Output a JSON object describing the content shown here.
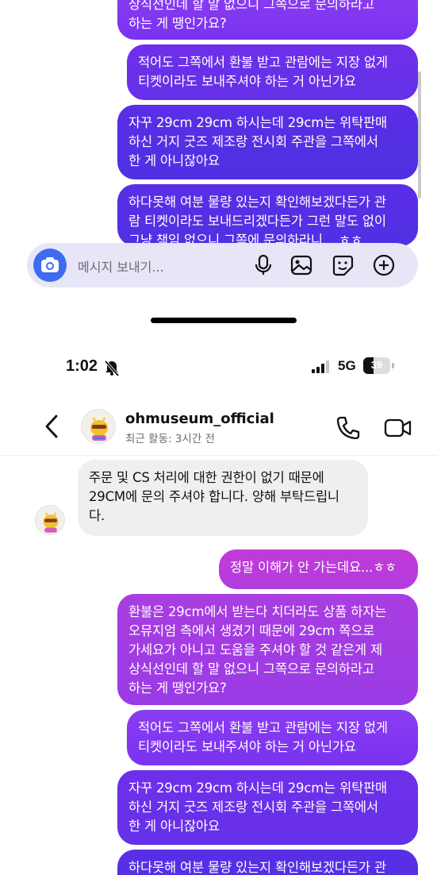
{
  "status_bar": {
    "time": "1:02",
    "network": "5G",
    "battery": "39",
    "battery_level": 0.39
  },
  "header": {
    "username": "ohmuseum_official",
    "activity": "최근 활동: 3시간 전"
  },
  "composer": {
    "placeholder": "메시지 보내기..."
  },
  "top_messages": [
    {
      "text": "상식선인데 할 말 없으니 그쪽으로 문의하라고\n하는 게 땡인가요?"
    },
    {
      "text": "적어도 그쪽에서 환불 받고 관람에는 지장 없게\n티켓이라도 보내주셔야 하는 거 아닌가요"
    },
    {
      "text": "자꾸 29cm 29cm 하시는데 29cm는 위탁판매\n하신 거지 굿즈 제조랑 전시회 주관을 그쪽에서\n한 게 아니잖아요"
    },
    {
      "text": "하다못해 여분 물량 있는지 확인해보겠다든가 관\n람 티켓이라도 보내드리겠다든가 그런 말도 없이\n그냥 책임 없으니 그쪽에 문의하라니... ㅎㅎ"
    }
  ],
  "bottom_messages": {
    "incoming": "주문 및 CS 처리에 대한 권한이 없기 때문에\n29CM에 문의 주셔야 합니다. 양해 부탁드립니\n다.",
    "outgoing": [
      {
        "text": "정말 이해가 안 가는데요...ㅎㅎ"
      },
      {
        "text": "환불은 29cm에서 받는다 치더라도 상품 하자는\n오뮤지엄 측에서 생겼기 때문에 29cm 쪽으로\n가세요가 아니고 도움을 주셔야 할 것 같은게 제\n상식선인데 할 말 없으니 그쪽으로 문의하라고\n하는 게 땡인가요?"
      },
      {
        "text": "적어도 그쪽에서 환불 받고 관람에는 지장 없게\n티켓이라도 보내주셔야 하는 거 아닌가요"
      },
      {
        "text": "자꾸 29cm 29cm 하시는데 29cm는 위탁판매\n하신 거지 굿즈 제조랑 전시회 주관을 그쪽에서\n한 게 아니잖아요"
      },
      {
        "text": "하다못해 여분 물량 있는지 확인해보겠다든가 관"
      }
    ]
  },
  "colors": {
    "composer_bg": "#e7e6f6",
    "camera_button": "#3e6bf0",
    "bubble_purple": "#7a32ef",
    "bubble_violet": "#b13cdd",
    "incoming_bubble": "#efefef"
  },
  "icons": [
    "camera-icon",
    "microphone-icon",
    "image-icon",
    "sticker-icon",
    "plus-icon",
    "bell-off-icon",
    "signal-icon",
    "back-chevron-icon",
    "phone-icon",
    "video-icon"
  ]
}
